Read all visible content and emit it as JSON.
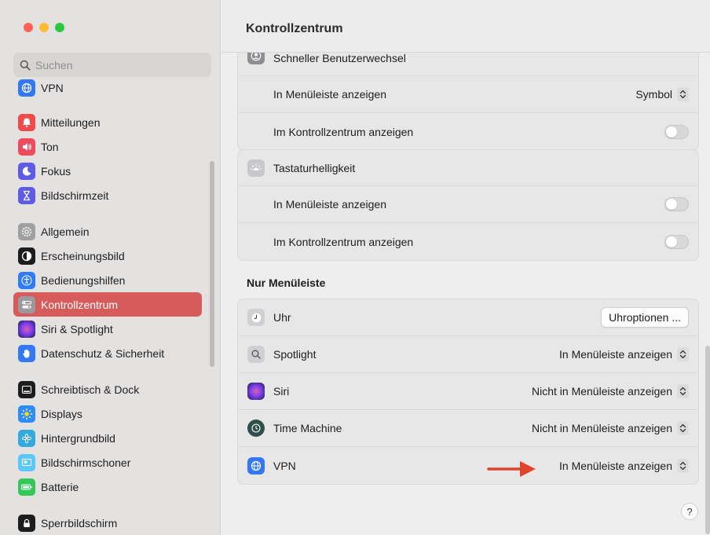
{
  "sidebar": {
    "search_placeholder": "Suchen",
    "items": [
      {
        "label": "VPN",
        "icon": "globe-icon",
        "color": "#3478f6"
      },
      {
        "label": "Mitteilungen",
        "icon": "bell-icon",
        "color": "#f04a4a"
      },
      {
        "label": "Ton",
        "icon": "speaker-icon",
        "color": "#ef4b5e"
      },
      {
        "label": "Fokus",
        "icon": "moon-icon",
        "color": "#5e5ce6"
      },
      {
        "label": "Bildschirmzeit",
        "icon": "hourglass-icon",
        "color": "#5e5ce6"
      },
      {
        "label": "Allgemein",
        "icon": "gear-icon",
        "color": "#9b9b9b"
      },
      {
        "label": "Erscheinungsbild",
        "icon": "appearance-icon",
        "color": "#1d1d1f"
      },
      {
        "label": "Bedienungshilfen",
        "icon": "accessibility-icon",
        "color": "#2f7cf6"
      },
      {
        "label": "Kontrollzentrum",
        "icon": "control-center-icon",
        "color": "#8e8e93"
      },
      {
        "label": "Siri & Spotlight",
        "icon": "siri-icon",
        "color": "#3b2f5e"
      },
      {
        "label": "Datenschutz & Sicherheit",
        "icon": "hand-icon",
        "color": "#3478f6"
      },
      {
        "label": "Schreibtisch & Dock",
        "icon": "dock-icon",
        "color": "#1d1d1f"
      },
      {
        "label": "Displays",
        "icon": "sun-icon",
        "color": "#2f8cf6"
      },
      {
        "label": "Hintergrundbild",
        "icon": "flower-icon",
        "color": "#34aadc"
      },
      {
        "label": "Bildschirmschoner",
        "icon": "screensaver-icon",
        "color": "#5ac8fa"
      },
      {
        "label": "Batterie",
        "icon": "battery-icon",
        "color": "#34c759"
      },
      {
        "label": "Sperrbildschirm",
        "icon": "lock-icon",
        "color": "#1d1d1f"
      }
    ],
    "active_label": "Kontrollzentrum"
  },
  "main": {
    "title": "Kontrollzentrum",
    "group_user_switch": {
      "title": "Schneller Benutzerwechsel",
      "row1_label": "In Menüleiste anzeigen",
      "row1_value": "Symbol",
      "row2_label": "Im Kontrollzentrum anzeigen"
    },
    "group_keyboard": {
      "title": "Tastaturhelligkeit",
      "row1_label": "In Menüleiste anzeigen",
      "row2_label": "Im Kontrollzentrum anzeigen"
    },
    "menubar_heading": "Nur Menüleiste",
    "menubar_rows": [
      {
        "label": "Uhr",
        "button": "Uhroptionen ..."
      },
      {
        "label": "Spotlight",
        "value": "In Menüleiste anzeigen"
      },
      {
        "label": "Siri",
        "value": "Nicht in Menüleiste anzeigen"
      },
      {
        "label": "Time Machine",
        "value": "Nicht in Menüleiste anzeigen"
      },
      {
        "label": "VPN",
        "value": "In Menüleiste anzeigen"
      }
    ],
    "help_label": "?"
  },
  "colors": {
    "accent_active": "#d85b5b",
    "arrow": "#e0432b"
  }
}
